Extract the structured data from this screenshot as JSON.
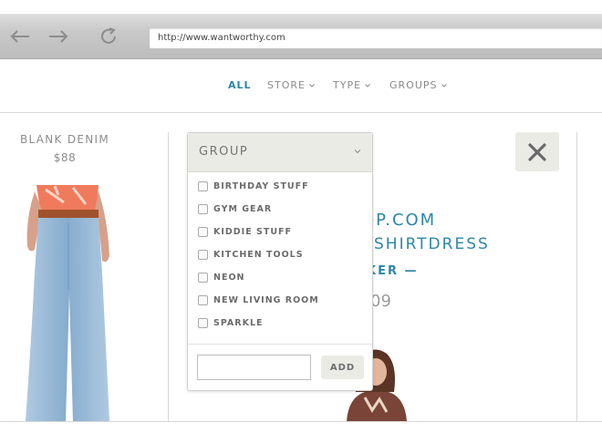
{
  "browser": {
    "url": "http://www.wantworthy.com",
    "icons": [
      "back-arrow-icon",
      "forward-arrow-icon",
      "reload-icon"
    ]
  },
  "nav": {
    "items": [
      {
        "label": "ALL",
        "active": true
      },
      {
        "label": "STORE",
        "icon": "chevron-down-icon"
      },
      {
        "label": "TYPE",
        "icon": "chevron-down-icon"
      },
      {
        "label": "GROUPS",
        "icon": "chevron-down-icon"
      }
    ],
    "active_color": "#2c86a8"
  },
  "product": {
    "name": "BLANK DENIM",
    "price": "$88"
  },
  "detail": {
    "store_fragment": "OP.COM",
    "title_fragment": "SHIRTDRESS",
    "brand_fragment": "KER —",
    "price_fragment": "09"
  },
  "close_icon": "close-x-icon",
  "group_dropdown": {
    "title": "GROUP",
    "options": [
      "BIRTHDAY STUFF",
      "GYM GEAR",
      "KIDDIE STUFF",
      "KITCHEN TOOLS",
      "NEON",
      "NEW LIVING ROOM",
      "SPARKLE"
    ],
    "input_value": "",
    "add_label": "ADD"
  }
}
